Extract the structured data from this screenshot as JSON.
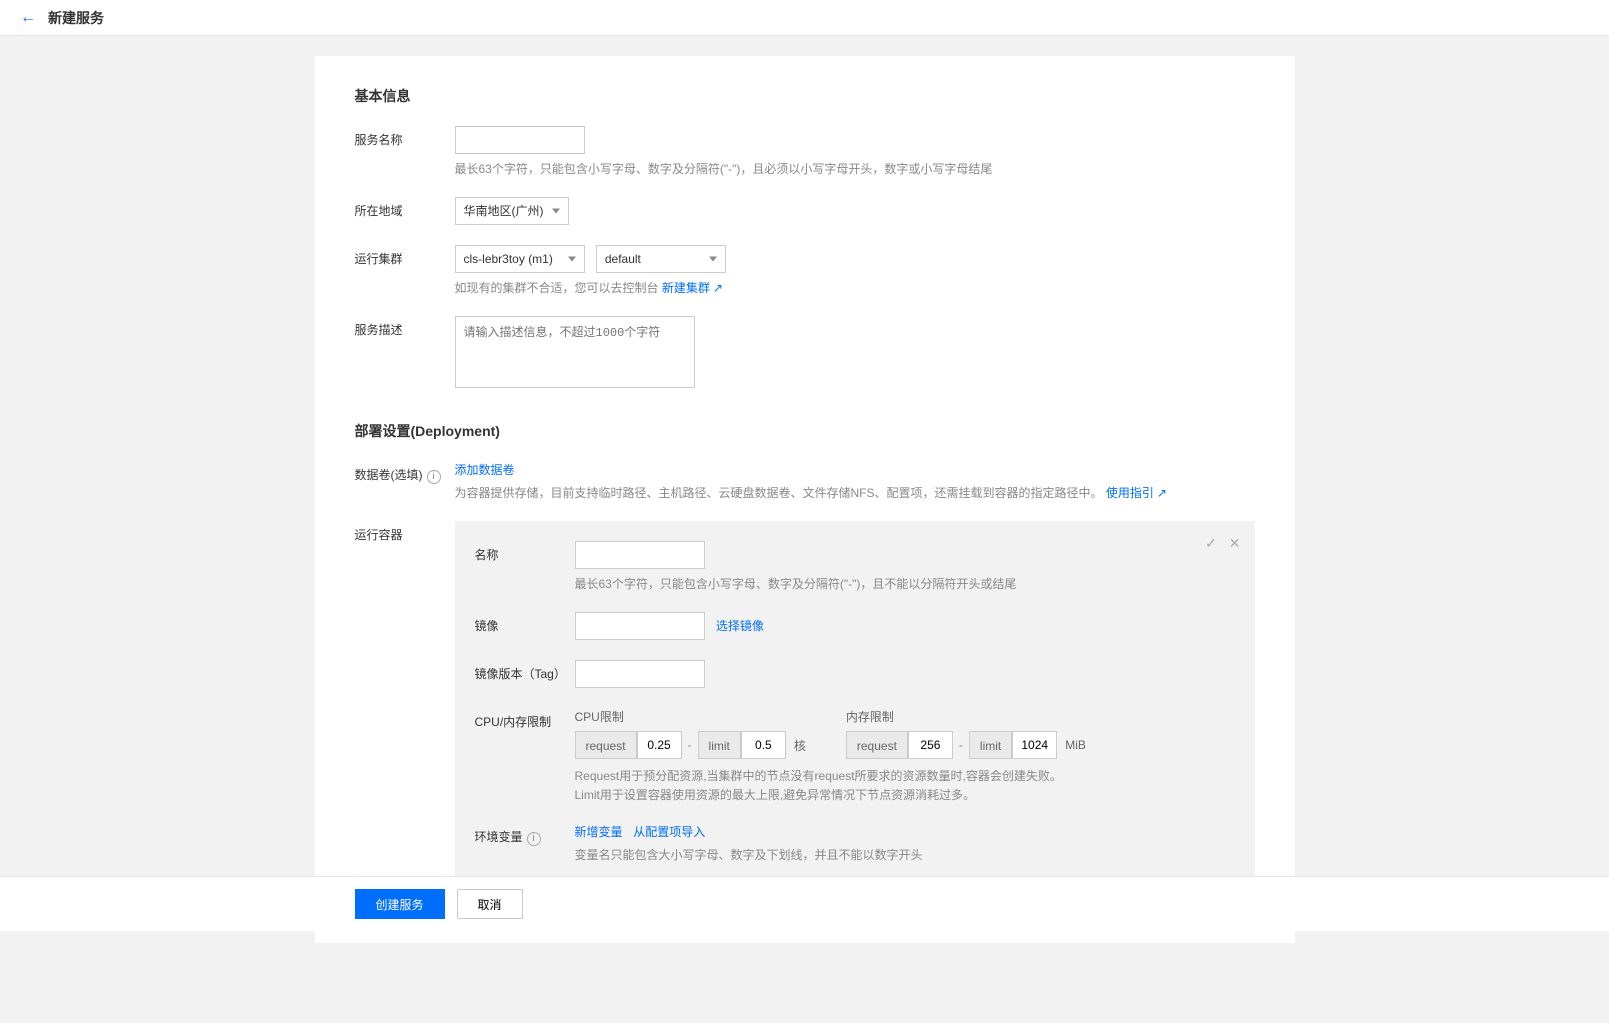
{
  "header": {
    "title": "新建服务"
  },
  "section1_title": "基本信息",
  "service_name": {
    "label": "服务名称",
    "hint": "最长63个字符，只能包含小写字母、数字及分隔符(\"-\")，且必须以小写字母开头，数字或小写字母结尾"
  },
  "region": {
    "label": "所在地域",
    "value": "华南地区(广州)"
  },
  "cluster": {
    "label": "运行集群",
    "cluster_value": "cls-lebr3toy (m1)",
    "ns_value": "default",
    "hint_pre": "如现有的集群不合适，您可以去控制台",
    "link": "新建集群"
  },
  "desc": {
    "label": "服务描述",
    "placeholder": "请输入描述信息，不超过1000个字符"
  },
  "section2_title": "部署设置(Deployment)",
  "volume": {
    "label": "数据卷(选填)",
    "link": "添加数据卷",
    "hint_pre": "为容器提供存储，目前支持临时路径、主机路径、云硬盘数据卷、文件存储NFS、配置项，还需挂载到容器的指定路径中。",
    "guide_link": "使用指引"
  },
  "container": {
    "label": "运行容器"
  },
  "c_name": {
    "label": "名称",
    "hint": "最长63个字符，只能包含小写字母、数字及分隔符(\"-\")，且不能以分隔符开头或结尾"
  },
  "c_image": {
    "label": "镜像",
    "link": "选择镜像"
  },
  "c_tag": {
    "label": "镜像版本（Tag）"
  },
  "c_limits": {
    "label": "CPU/内存限制",
    "cpu_title": "CPU限制",
    "cpu_req": "request",
    "cpu_req_val": "0.25",
    "cpu_limit": "limit",
    "cpu_limit_val": "0.5",
    "cpu_unit": "核",
    "mem_title": "内存限制",
    "mem_req": "request",
    "mem_req_val": "256",
    "mem_limit": "limit",
    "mem_limit_val": "1024",
    "mem_unit": "MiB",
    "hint1": "Request用于预分配资源,当集群中的节点没有request所要求的资源数量时,容器会创建失败。",
    "hint2": "Limit用于设置容器使用资源的最大上限,避免异常情况下节点资源消耗过多。"
  },
  "c_env": {
    "label": "环境变量",
    "link1": "新增变量",
    "link2": "从配置项导入",
    "hint": "变量名只能包含大小写字母、数字及下划线，并且不能以数字开头"
  },
  "footer": {
    "submit": "创建服务",
    "cancel": "取消"
  }
}
